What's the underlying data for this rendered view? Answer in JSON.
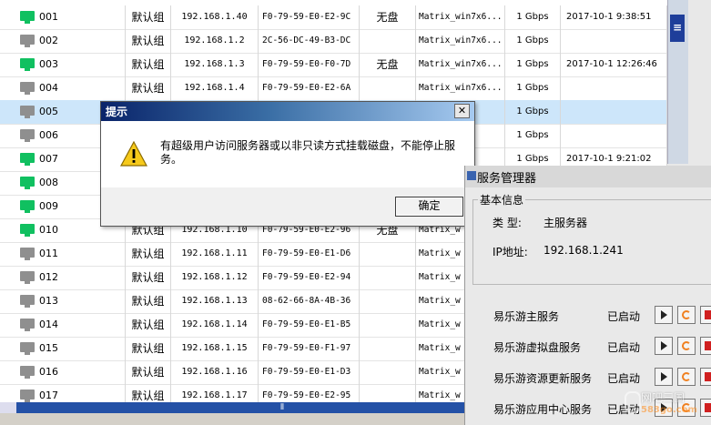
{
  "clients": [
    {
      "id": "001",
      "online": true,
      "group": "默认组",
      "ip": "192.168.1.40",
      "mac": "F0-79-59-E0-E2-9C",
      "disk": "无盘",
      "image": "Matrix_win7x6...",
      "net": "1 Gbps",
      "time": "2017-10-1 9:38:51"
    },
    {
      "id": "002",
      "online": false,
      "group": "默认组",
      "ip": "192.168.1.2",
      "mac": "2C-56-DC-49-B3-DC",
      "disk": "",
      "image": "Matrix_win7x6...",
      "net": "1 Gbps",
      "time": ""
    },
    {
      "id": "003",
      "online": true,
      "group": "默认组",
      "ip": "192.168.1.3",
      "mac": "F0-79-59-E0-F0-7D",
      "disk": "无盘",
      "image": "Matrix_win7x6...",
      "net": "1 Gbps",
      "time": "2017-10-1 12:26:46"
    },
    {
      "id": "004",
      "online": false,
      "group": "默认组",
      "ip": "192.168.1.4",
      "mac": "F0-79-59-E0-E2-6A",
      "disk": "",
      "image": "Matrix_win7x6...",
      "net": "1 Gbps",
      "time": ""
    },
    {
      "id": "005",
      "online": false,
      "group": "",
      "ip": "",
      "mac": "",
      "disk": "",
      "image": "7x6...",
      "net": "1 Gbps",
      "time": ""
    },
    {
      "id": "006",
      "online": false,
      "group": "",
      "ip": "",
      "mac": "",
      "disk": "",
      "image": "7x6...",
      "net": "1 Gbps",
      "time": ""
    },
    {
      "id": "007",
      "online": true,
      "group": "",
      "ip": "",
      "mac": "",
      "disk": "",
      "image": "7x6...",
      "net": "1 Gbps",
      "time": "2017-10-1 9:21:02"
    },
    {
      "id": "008",
      "online": true,
      "group": "",
      "ip": "",
      "mac": "",
      "disk": "",
      "image": "",
      "net": "",
      "time": ""
    },
    {
      "id": "009",
      "online": true,
      "group": "",
      "ip": "",
      "mac": "",
      "disk": "",
      "image": "",
      "net": "",
      "time": ""
    },
    {
      "id": "010",
      "online": true,
      "group": "默认组",
      "ip": "192.168.1.10",
      "mac": "F0-79-59-E0-E2-96",
      "disk": "无盘",
      "image": "Matrix_w",
      "net": "",
      "time": ""
    },
    {
      "id": "011",
      "online": false,
      "group": "默认组",
      "ip": "192.168.1.11",
      "mac": "F0-79-59-E0-E1-D6",
      "disk": "",
      "image": "Matrix_w",
      "net": "",
      "time": ""
    },
    {
      "id": "012",
      "online": false,
      "group": "默认组",
      "ip": "192.168.1.12",
      "mac": "F0-79-59-E0-E2-94",
      "disk": "",
      "image": "Matrix_w",
      "net": "",
      "time": ""
    },
    {
      "id": "013",
      "online": false,
      "group": "默认组",
      "ip": "192.168.1.13",
      "mac": "08-62-66-8A-4B-36",
      "disk": "",
      "image": "Matrix_w",
      "net": "",
      "time": ""
    },
    {
      "id": "014",
      "online": false,
      "group": "默认组",
      "ip": "192.168.1.14",
      "mac": "F0-79-59-E0-E1-B5",
      "disk": "",
      "image": "Matrix_w",
      "net": "",
      "time": ""
    },
    {
      "id": "015",
      "online": false,
      "group": "默认组",
      "ip": "192.168.1.15",
      "mac": "F0-79-59-E0-F1-97",
      "disk": "",
      "image": "Matrix_w",
      "net": "",
      "time": ""
    },
    {
      "id": "016",
      "online": false,
      "group": "默认组",
      "ip": "192.168.1.16",
      "mac": "F0-79-59-E0-E1-D3",
      "disk": "",
      "image": "Matrix_w",
      "net": "",
      "time": ""
    },
    {
      "id": "017",
      "online": false,
      "group": "默认组",
      "ip": "192.168.1.17",
      "mac": "F0-79-59-E0-E2-95",
      "disk": "",
      "image": "Matrix_w",
      "net": "",
      "time": ""
    }
  ],
  "selected_row": "005",
  "alert": {
    "title": "提示",
    "close_glyph": "✕",
    "message": "有超级用户访问服务器或以非只读方式挂载磁盘，不能停止服务。",
    "ok_label": "确定"
  },
  "server": {
    "title": "服务管理器",
    "basic_legend": "基本信息",
    "type_label": "类 型:",
    "type_value": "主服务器",
    "ip_label": "IP地址:",
    "ip_value": "192.168.1.241",
    "services": [
      {
        "name": "易乐游主服务",
        "status": "已启动"
      },
      {
        "name": "易乐游虚拟盘服务",
        "status": "已启动"
      },
      {
        "name": "易乐游资源更新服务",
        "status": "已启动"
      },
      {
        "name": "易乐游应用中心服务",
        "status": "已启动"
      }
    ]
  },
  "scrollbar": {
    "thumb_glyph": "≡",
    "grip_glyph": "⦀"
  },
  "watermark": {
    "text": "网吧三国",
    "url": "583go.com"
  },
  "colors": {
    "online": "#10c060",
    "offline": "#8f8f8f",
    "selected": "#cde6fa",
    "title_bar": "#0a246a"
  }
}
